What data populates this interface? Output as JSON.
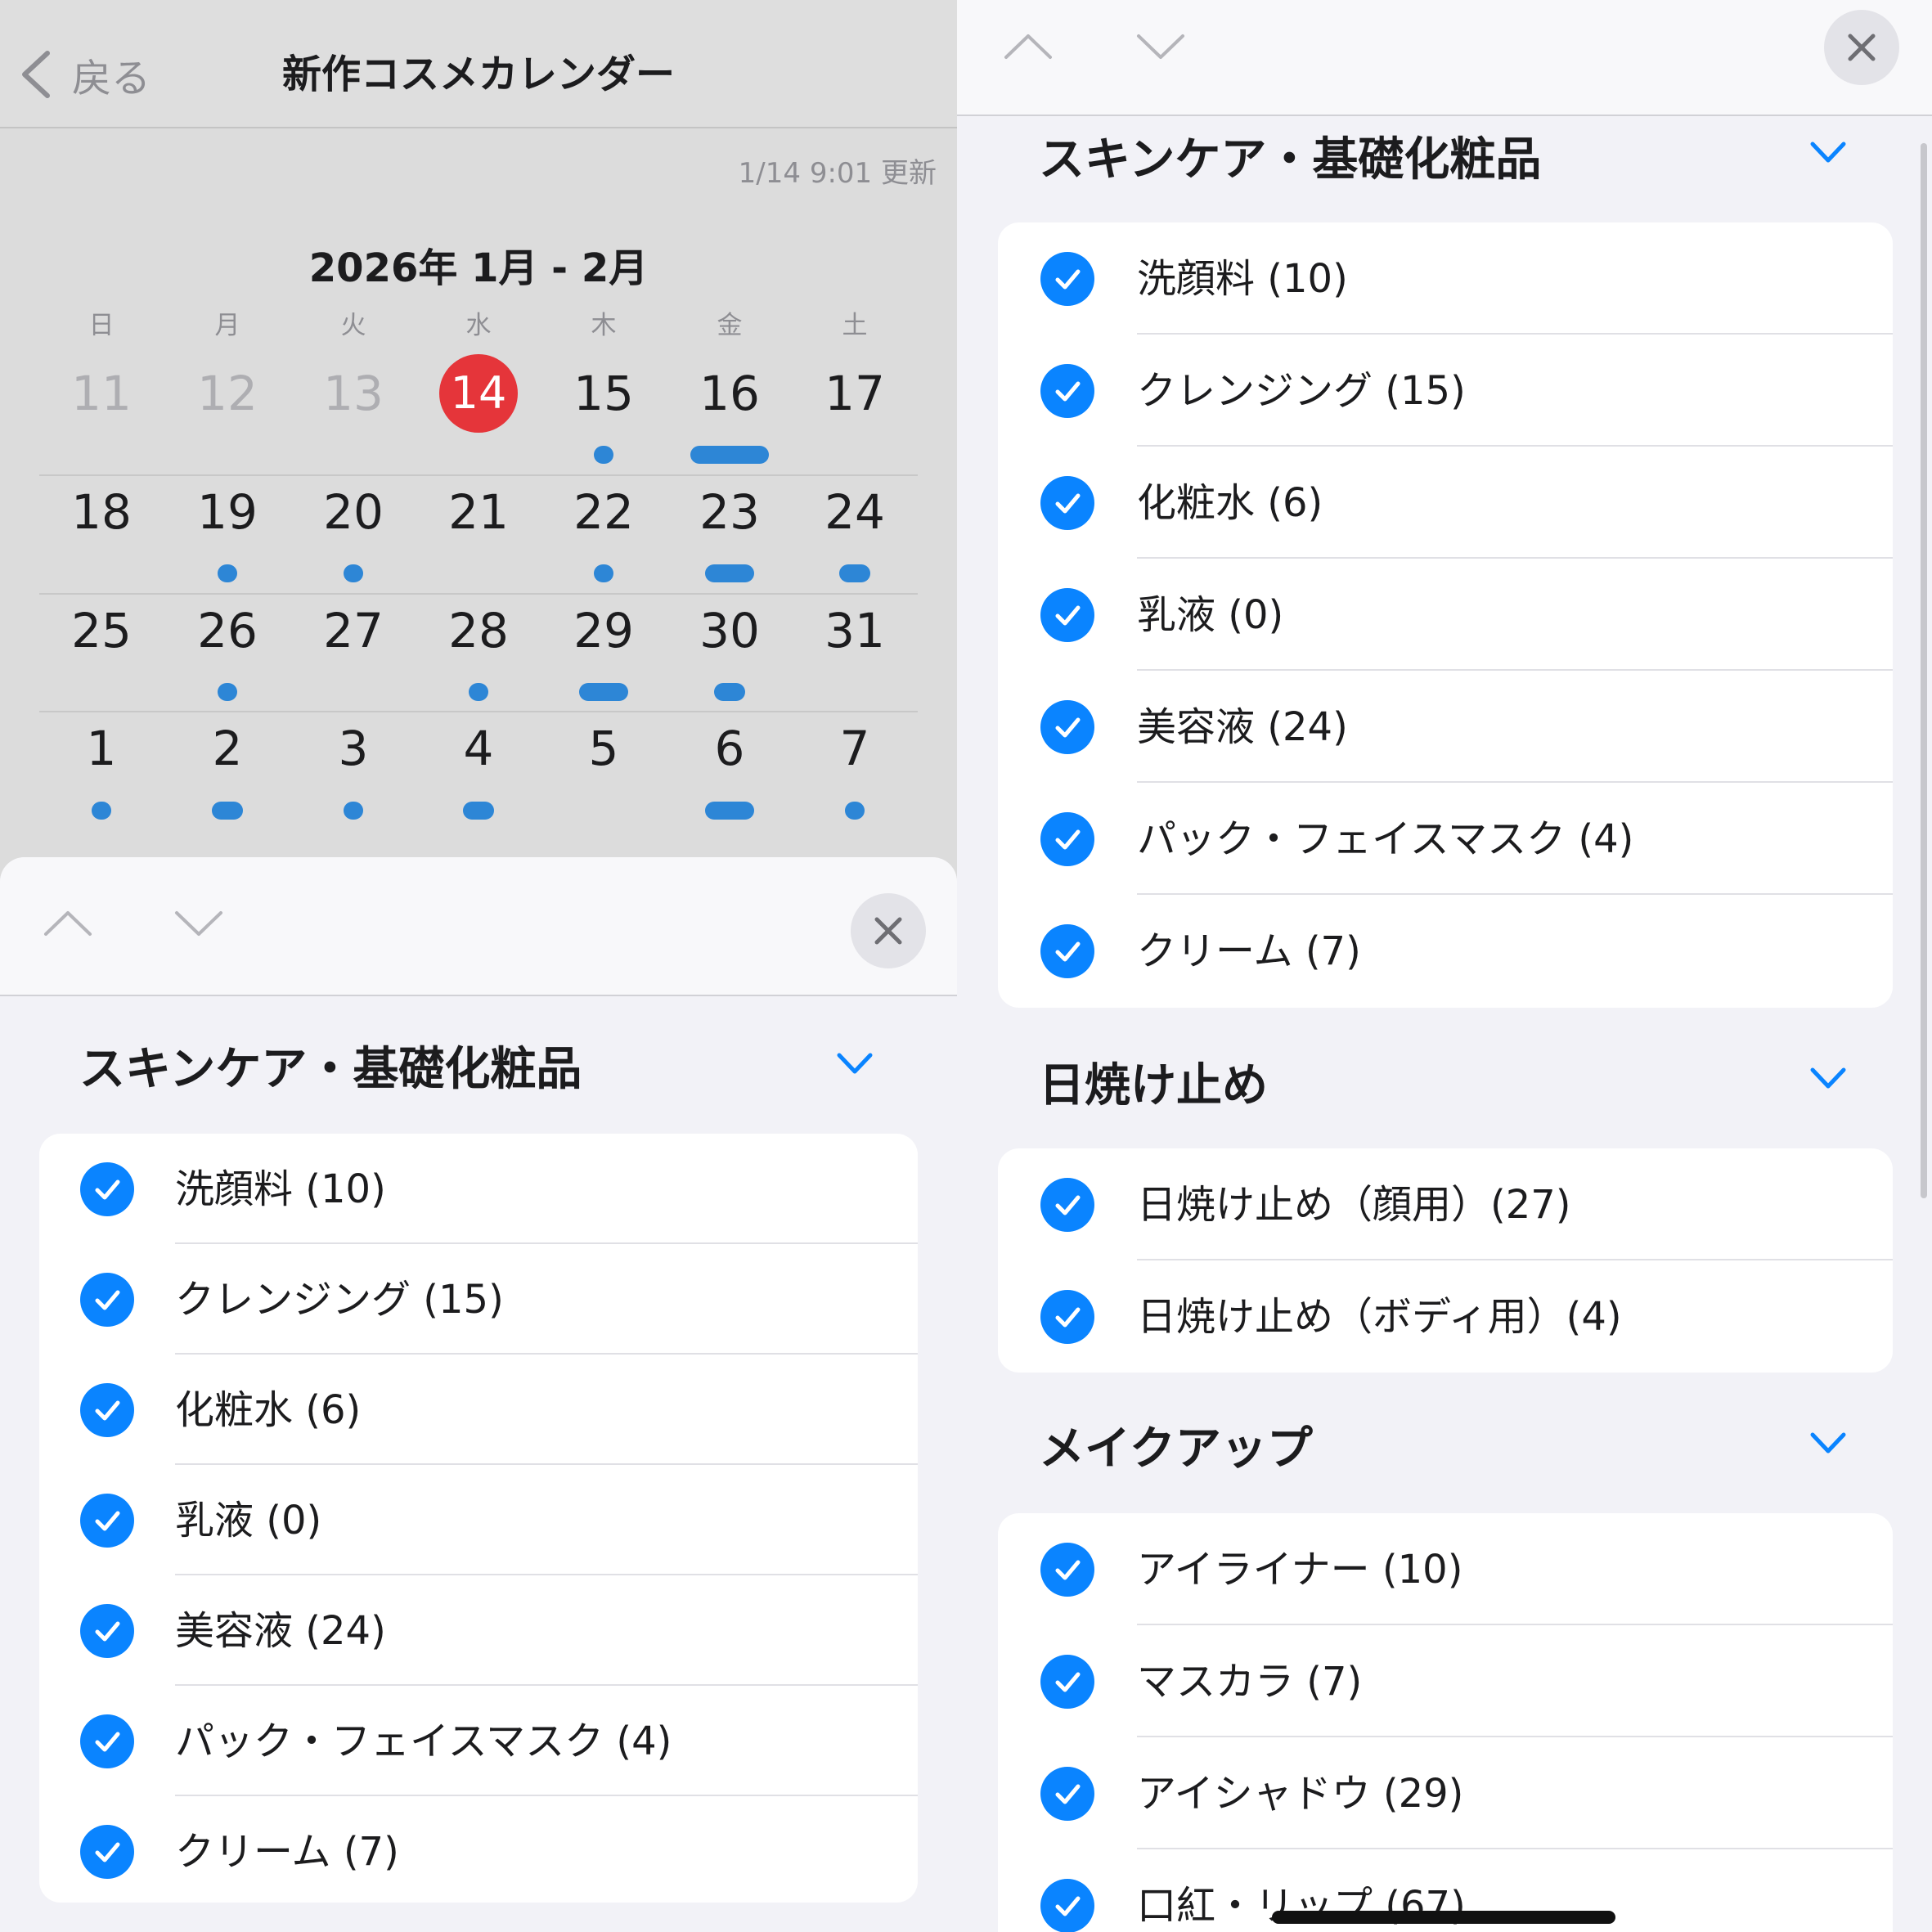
{
  "nav": {
    "back_label": "戻る",
    "title": "新作コスメカレンダー"
  },
  "updated": "1/14 9:01 更新",
  "calendar": {
    "month_label": "2026年 1月 - 2月",
    "weekdays": [
      "日",
      "月",
      "火",
      "水",
      "木",
      "金",
      "土"
    ],
    "today": "14",
    "weeks": [
      [
        {
          "day": "11",
          "past": true,
          "marker": "none"
        },
        {
          "day": "12",
          "past": true,
          "marker": "none"
        },
        {
          "day": "13",
          "past": true,
          "marker": "none"
        },
        {
          "day": "14",
          "today": true,
          "marker": "none"
        },
        {
          "day": "15",
          "marker": "dot"
        },
        {
          "day": "16",
          "marker": "long"
        },
        {
          "day": "17",
          "marker": "none"
        }
      ],
      [
        {
          "day": "18",
          "marker": "none"
        },
        {
          "day": "19",
          "marker": "dot"
        },
        {
          "day": "20",
          "marker": "dot"
        },
        {
          "day": "21",
          "marker": "none"
        },
        {
          "day": "22",
          "marker": "dot"
        },
        {
          "day": "23",
          "marker": "medium"
        },
        {
          "day": "24",
          "marker": "short"
        }
      ],
      [
        {
          "day": "25",
          "marker": "none"
        },
        {
          "day": "26",
          "marker": "dot"
        },
        {
          "day": "27",
          "marker": "none"
        },
        {
          "day": "28",
          "marker": "dot"
        },
        {
          "day": "29",
          "marker": "medium"
        },
        {
          "day": "30",
          "marker": "short"
        },
        {
          "day": "31",
          "marker": "none"
        }
      ],
      [
        {
          "day": "1",
          "marker": "dot"
        },
        {
          "day": "2",
          "marker": "short"
        },
        {
          "day": "3",
          "marker": "dot"
        },
        {
          "day": "4",
          "marker": "short"
        },
        {
          "day": "5",
          "marker": "none"
        },
        {
          "day": "6",
          "marker": "medium"
        },
        {
          "day": "7",
          "marker": "dot"
        }
      ]
    ]
  },
  "filters": {
    "skincare": {
      "title": "スキンケア・基礎化粧品",
      "items": [
        "洗顔料 (10)",
        "クレンジング (15)",
        "化粧水 (6)",
        "乳液 (0)",
        "美容液 (24)",
        "パック・フェイスマスク (4)",
        "クリーム (7)"
      ]
    },
    "sunscreen": {
      "title": "日焼け止め",
      "items": [
        "日焼け止め（顔用）(27)",
        "日焼け止め（ボディ用）(4)"
      ]
    },
    "makeup": {
      "title": "メイクアップ",
      "items": [
        "アイライナー (10)",
        "マスカラ (7)",
        "アイシャドウ (29)",
        "口紅・リップ (67)"
      ]
    }
  },
  "colors": {
    "accent": "#0a84ff",
    "today": "#e5353a",
    "event_marker": "#2d86d6"
  },
  "icons": [
    "chevron-left-icon",
    "chevron-up-icon",
    "chevron-down-icon",
    "close-icon",
    "checkmark-icon"
  ]
}
